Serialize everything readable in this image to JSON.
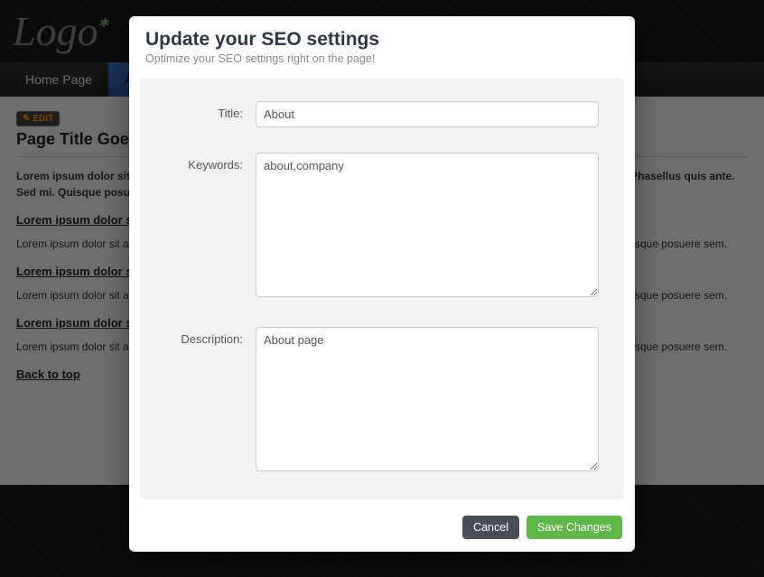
{
  "logo": {
    "text": "Logo"
  },
  "nav": {
    "items": [
      {
        "label": "Home Page"
      },
      {
        "label": "About"
      }
    ]
  },
  "edit_badge": "EDIT",
  "page": {
    "title": "Page Title Goes Here",
    "intro": "Lorem ipsum dolor sit amet, consectetur adipiscing elit. Quisque posuere sem sed libero viverra, purus augue eu felis. Phasellus quis ante. Sed mi. Quisque posuere sem sed mauris, consectetur sodales eget, dictum ac, ligula.",
    "section1_title": "Lorem ipsum dolor sit",
    "section1_body": "Lorem ipsum dolor sit amet, consectetur adipiscing elit. Quisque posuere ipsum a tincidunt felis. Phasellus quis ante. Sed mi. Quisque posuere sem.",
    "section2_title": "Lorem ipsum dolor sit",
    "section2_body": "Lorem ipsum dolor sit amet, consectetur adipiscing elit. Quisque posuere ipsum a tincidunt felis. Phasellus quis ante. Sed mi. Quisque posuere sem.",
    "section3_title": "Lorem ipsum dolor sit",
    "section3_body": "Lorem ipsum dolor sit amet, consectetur adipiscing elit. Quisque posuere ipsum a tincidunt felis. Phasellus quis ante. Sed mi. Quisque posuere sem.",
    "back_to_top": "Back to top"
  },
  "modal": {
    "title": "Update your SEO settings",
    "subtitle": "Optimize your SEO settings right on the page!",
    "labels": {
      "title": "Title:",
      "keywords": "Keywords:",
      "description": "Description:"
    },
    "values": {
      "title": "About",
      "keywords": "about,company",
      "description": "About page"
    },
    "buttons": {
      "cancel": "Cancel",
      "save": "Save Changes"
    }
  }
}
